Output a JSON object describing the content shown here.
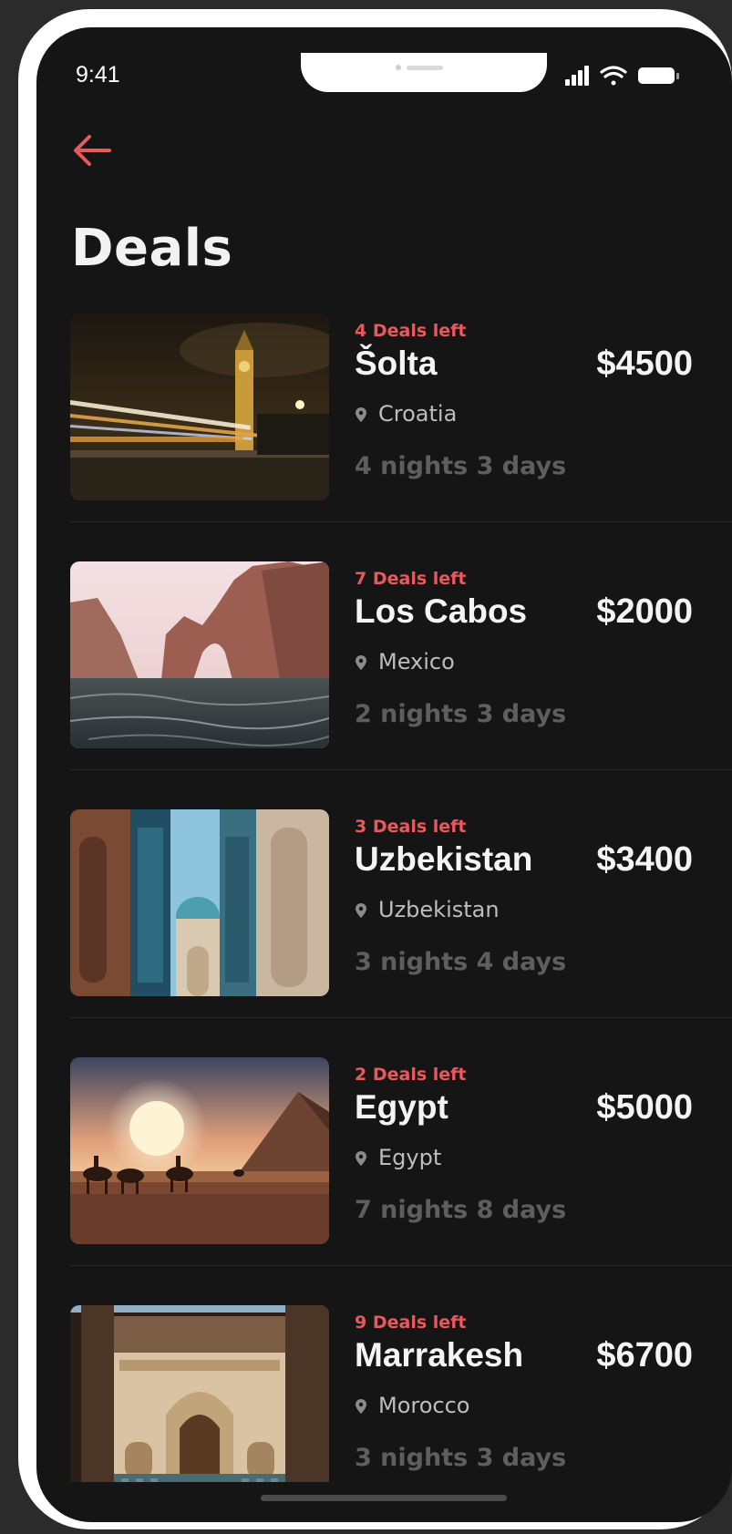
{
  "status_bar": {
    "time": "9:41"
  },
  "header": {
    "title": "Deals"
  },
  "deals": [
    {
      "deals_left": "4 Deals left",
      "name": "Šolta",
      "price": "$4500",
      "location": "Croatia",
      "duration": "4 nights 3 days",
      "image": "night-city-clock-tower"
    },
    {
      "deals_left": "7 Deals left",
      "name": "Los Cabos",
      "price": "$2000",
      "location": "Mexico",
      "duration": "2 nights 3 days",
      "image": "sea-rock-arch"
    },
    {
      "deals_left": "3 Deals left",
      "name": "Uzbekistan",
      "price": "$3400",
      "location": "Uzbekistan",
      "duration": "3 nights 4 days",
      "image": "blue-tiled-mosque"
    },
    {
      "deals_left": "2 Deals left",
      "name": "Egypt",
      "price": "$5000",
      "location": "Egypt",
      "duration": "7 nights 8 days",
      "image": "desert-pyramid-camels"
    },
    {
      "deals_left": "9 Deals left",
      "name": "Marrakesh",
      "price": "$6700",
      "location": "Morocco",
      "duration": "3 nights 3 days",
      "image": "moroccan-courtyard"
    }
  ],
  "colors": {
    "accent": "#e65a5d",
    "background": "#151515",
    "text": "#f4f4f4",
    "muted": "#5e5e5e"
  }
}
